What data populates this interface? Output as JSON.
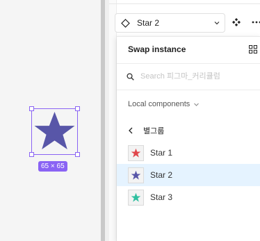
{
  "canvas": {
    "size_badge": "65 × 65",
    "star_color": "#5856a8",
    "selection_color": "#8a63f4"
  },
  "instance": {
    "name": "Star 2"
  },
  "swap": {
    "title": "Swap instance",
    "search_placeholder": "Search 피그마_커리큘럼",
    "search_value": "",
    "section_label": "Local components",
    "group_label": "별그룹",
    "items": [
      {
        "label": "Star 1",
        "color": "#e0474c",
        "selected": false
      },
      {
        "label": "Star 2",
        "color": "#5856a8",
        "selected": true
      },
      {
        "label": "Star 3",
        "color": "#2ebf9f",
        "selected": false
      }
    ]
  }
}
